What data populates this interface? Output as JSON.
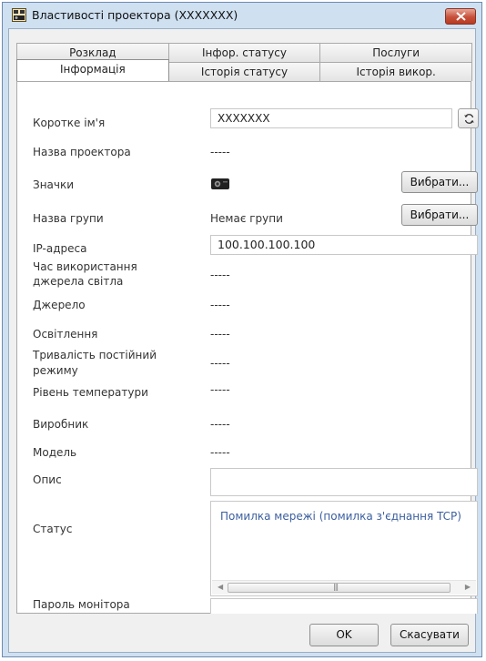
{
  "window": {
    "title": "Властивості проектора (XXXXXXX)"
  },
  "tabs": {
    "back_row": [
      "Розклад",
      "Інфор. статусу",
      "Послуги"
    ],
    "front_row": [
      "Інформація",
      "Історія статусу",
      "Історія викор."
    ],
    "active": "Інформація"
  },
  "fields": {
    "short_name": {
      "label": "Коротке ім'я",
      "value": "XXXXXXX"
    },
    "projector_name": {
      "label": "Назва проектора",
      "value": "-----"
    },
    "icons": {
      "label": "Значки",
      "icon": "projector-icon",
      "button": "Вибрати..."
    },
    "group_name": {
      "label": "Назва групи",
      "value": "Немає групи",
      "button": "Вибрати..."
    },
    "ip_address": {
      "label": "IP-адреса",
      "value": "100.100.100.100"
    },
    "light_source_time": {
      "label_line1": "Час використання",
      "label_line2": "джерела світла",
      "value": "-----"
    },
    "source": {
      "label": "Джерело",
      "value": "-----"
    },
    "brightness": {
      "label": "Освітлення",
      "value": "-----"
    },
    "constant_mode": {
      "label_line1": "Тривалість постійний",
      "label_line2": "режиму",
      "value": "-----"
    },
    "temperature": {
      "label": "Рівень температури",
      "value": "-----"
    },
    "manufacturer": {
      "label": "Виробник",
      "value": "-----"
    },
    "model": {
      "label": "Модель",
      "value": "-----"
    },
    "description": {
      "label": "Опис",
      "value": ""
    },
    "status": {
      "label": "Статус",
      "value": "Помилка мережі (помилка з'єднання TCP)"
    },
    "monitor_password": {
      "label": "Пароль монітора",
      "value": ""
    }
  },
  "footer": {
    "ok": "OK",
    "cancel": "Скасувати"
  },
  "colors": {
    "accent": "#3b5fa0",
    "close": "#c7503a",
    "frame": "#cfe0f1"
  }
}
